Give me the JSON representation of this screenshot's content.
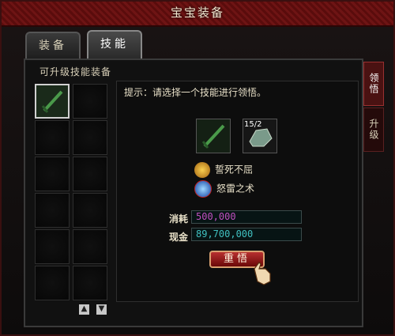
{
  "window": {
    "title": "宝宝装备"
  },
  "tabs": [
    {
      "label": "装备"
    },
    {
      "label": "技能"
    }
  ],
  "side_tabs": [
    {
      "label": "领悟"
    },
    {
      "label": "升级"
    }
  ],
  "left": {
    "title": "可升级技能装备"
  },
  "main": {
    "hint": "提示：请选择一个技能进行领悟。",
    "stone_badge": "15/2",
    "skills": [
      {
        "name": "誓死不屈"
      },
      {
        "name": "怒雷之术"
      }
    ],
    "cost_label": "消耗",
    "cost_value": "500,000",
    "cash_label": "现金",
    "cash_value": "89,700,000",
    "button_label": "重悟"
  },
  "colors": {
    "cost": "#c050c0",
    "cash": "#40c0c0",
    "accent": "#6e1414"
  }
}
